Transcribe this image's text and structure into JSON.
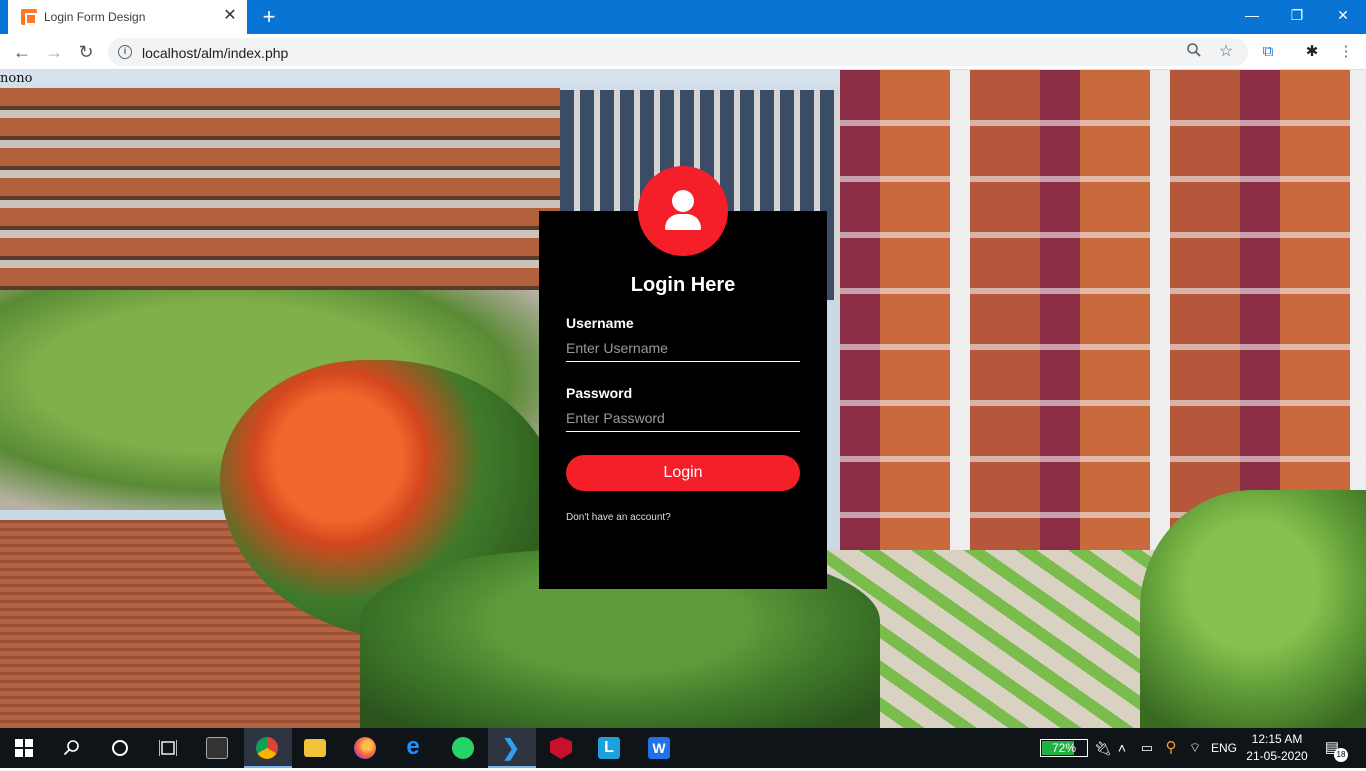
{
  "browser": {
    "tab_title": "Login Form Design",
    "tab_close": "✕",
    "new_tab": "+",
    "url": "localhost/alm/index.php",
    "window_controls": {
      "minimize": "—",
      "restore": "❐",
      "close": "✕"
    },
    "nav": {
      "back": "←",
      "forward": "→",
      "reload": "↻"
    },
    "icons": {
      "zoom": "zoom-icon",
      "bookmark": "star-icon",
      "extension": "extension-icon",
      "profile": "profile-icon",
      "menu": "more-vert-icon"
    }
  },
  "page": {
    "debug_text": "nono",
    "background": "school-campus-photo"
  },
  "login": {
    "title": "Login Here",
    "username_label": "Username",
    "username_placeholder": "Enter Username",
    "username_value": "",
    "password_label": "Password",
    "password_placeholder": "Enter Password",
    "password_value": "",
    "button_label": "Login",
    "signup_text": "Don't have an account?",
    "accent_color": "#f51f2a"
  },
  "taskbar": {
    "battery_percent": "72%",
    "battery_level": 0.72,
    "language": "ENG",
    "time": "12:15 AM",
    "date": "21-05-2020",
    "notification_count": "18",
    "apps": [
      "start",
      "search",
      "cortana",
      "task-view",
      "terminal",
      "chrome",
      "file-explorer",
      "firefox",
      "edge",
      "whatsapp",
      "vscode",
      "mcafee",
      "l-app",
      "wps"
    ]
  }
}
